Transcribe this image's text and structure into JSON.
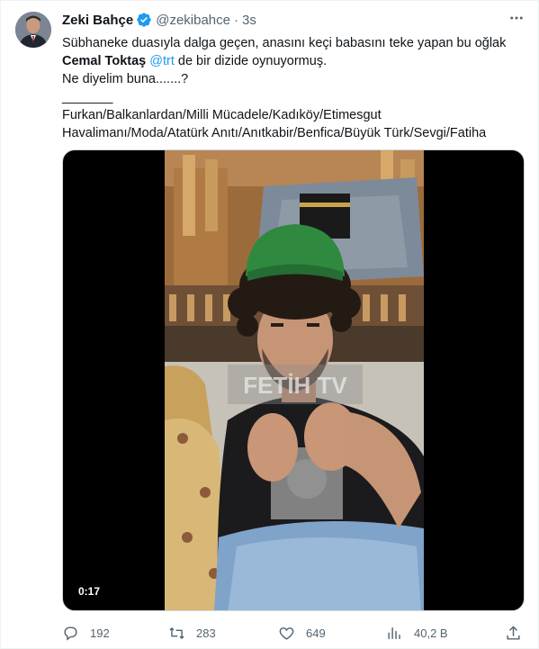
{
  "tweet": {
    "author_name": "Zeki Bahçe",
    "handle": "@zekibahce",
    "separator": "·",
    "time": "3s",
    "line1": "Sübhaneke duasıyla dalga geçen, anasını keçi babasını teke yapan bu oğlak",
    "line2_bold": "Cemal Toktaş",
    "line2_mention": "@trt",
    "line2_rest": " de bir dizide oynuyormuş.",
    "line3": "Ne diyelim buna.......?",
    "line4": "_______",
    "line5": "Furkan/Balkanlardan/Milli Mücadele/Kadıköy/Etimesgut",
    "line6": "Havalimanı/Moda/Atatürk Anıtı/Anıtkabir/Benfica/Büyük Türk/Sevgi/Fatiha"
  },
  "media": {
    "duration": "0:17",
    "watermark": "FETİH TV"
  },
  "actions": {
    "replies": "192",
    "retweets": "283",
    "likes": "649",
    "views": "40,2 B"
  },
  "icons": {
    "verified": "verified-badge-icon",
    "more": "more-icon",
    "reply": "reply-icon",
    "retweet": "retweet-icon",
    "like": "like-icon",
    "views": "views-icon",
    "share": "share-icon"
  },
  "colors": {
    "accent": "#1d9bf0",
    "text": "#0f1419",
    "secondary": "#536471"
  }
}
